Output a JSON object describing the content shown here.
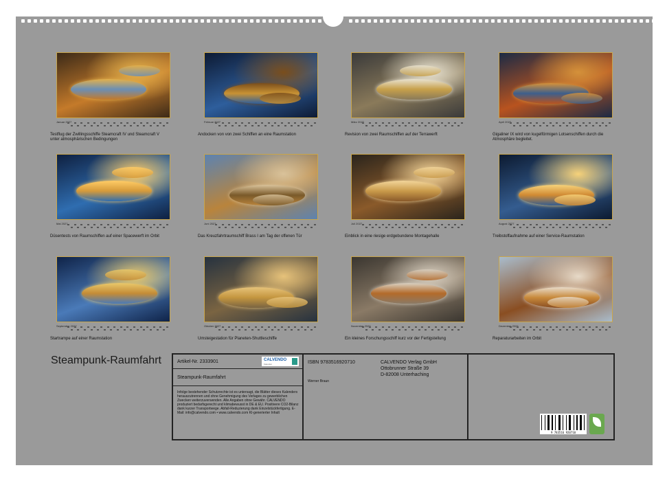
{
  "months": [
    {
      "name": "Januar 2027",
      "caption": "Testflug der Zwillingsschiffe Steamcraft IV und Steamcraft V unter atmosphärischen Bedingungen",
      "colors": [
        "#3c2a18",
        "#c47a2a",
        "#6b8fb5",
        "#e3b04b"
      ]
    },
    {
      "name": "Februar 2027",
      "caption": "Andocken von von zwei Schiffen an eine Raumstation",
      "colors": [
        "#0d1a33",
        "#2e5e9c",
        "#c89234",
        "#7a4e1c"
      ]
    },
    {
      "name": "März 2027",
      "caption": "Revision von zwei Raumschiffen auf der Terrawerft",
      "colors": [
        "#3a3a3a",
        "#8a7a5a",
        "#c7a04a",
        "#e8e2d0"
      ]
    },
    {
      "name": "April 2027",
      "caption": "Gigaliner IX wird von kugelförmigen Lotsenschiffen durch die Atmosphäre begleitet.",
      "colors": [
        "#1b2a45",
        "#b8531f",
        "#3d5f8c",
        "#d4913a"
      ]
    },
    {
      "name": "Mai 2027",
      "caption": "Düsentests von Raumschiffen auf einer Spacewerft im Orbit",
      "colors": [
        "#0f2040",
        "#2f6db0",
        "#d59a3a",
        "#ffcc66"
      ]
    },
    {
      "name": "Juni 2027",
      "caption": "Das Kreuzfahrtraumschiff Brass I am Tag der offenen Tür",
      "colors": [
        "#5d83b0",
        "#b9843c",
        "#7a5a2a",
        "#d9c29a"
      ]
    },
    {
      "name": "Juli 2027",
      "caption": "Einblick in eine riesige erdgebundene Montagehalle",
      "colors": [
        "#2a241c",
        "#8a5a2a",
        "#c99a4a",
        "#f2d59a"
      ]
    },
    {
      "name": "August 2027",
      "caption": "Treibstoffaufnahme auf einer Service-Raumstation",
      "colors": [
        "#0c1a30",
        "#345c8f",
        "#d08a33",
        "#f6d27a"
      ]
    },
    {
      "name": "September 2027",
      "caption": "Startrampe auf einer Raumstation",
      "colors": [
        "#0f2348",
        "#4a7ab8",
        "#c48c36",
        "#e9c86a"
      ]
    },
    {
      "name": "Oktober 2027",
      "caption": "Umsteigestation für Planeten-Shuttleschiffe",
      "colors": [
        "#26323f",
        "#7a6442",
        "#c4963f",
        "#e6c27a"
      ]
    },
    {
      "name": "November 2027",
      "caption": "Ein kleines Forschungsschiff kurz vor der Fertigstellung",
      "colors": [
        "#3a3630",
        "#8a7a66",
        "#b36a2a",
        "#d8cfc0"
      ]
    },
    {
      "name": "Dezember 2027",
      "caption": "Reparaturarbeiten im Orbit",
      "colors": [
        "#a9bccc",
        "#8a4e22",
        "#c88a3c",
        "#e7dac8"
      ]
    }
  ],
  "imprint": {
    "title": "Steampunk-Raumfahrt",
    "article": "Artikel-Nr. 2333901",
    "logo": "CALVENDO",
    "logo_sub": "Kalender",
    "subtitle": "Steampunk-Raumfahrt",
    "legal": "Infolge bestehender Schutzrechte ist es untersagt, die Blätter dieses Kalenders herauszutrennen und ohne Genehmigung des Verlages zu gewerblichen Zwecken weiterzuverwenden. Alle Angaben ohne Gewähr. CALVENDO produziert bedarfsgerecht und klimabewusst in DE & EU. Positivere CO2-Bilanz dank kurzer Transportwege. Abfall-Reduzierung dank Einzelstückfertigung. E-Mail: info@calvendo.com • www.calvendo.com KI-generierter Inhalt",
    "isbn": "ISBN 9783516920710",
    "author": "Werner Braun",
    "publisher1": "CALVENDO Verlag GmbH",
    "publisher2": "Ottobrunner Straße 39",
    "publisher3": "D-82008 Unterhaching",
    "barcode_text": "9 783516 920710"
  }
}
